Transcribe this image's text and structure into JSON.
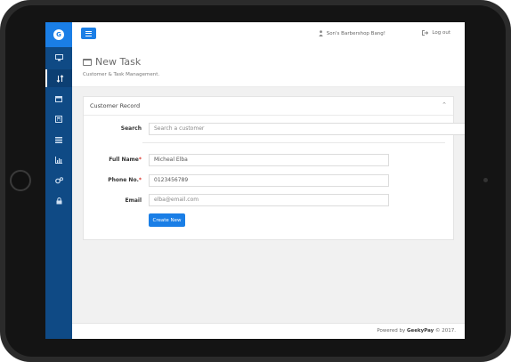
{
  "topbar": {
    "user_name": "Son's Barbershop Bang!",
    "logout_label": "Log out"
  },
  "page": {
    "title": "New Task",
    "subtitle": "Customer & Task Management."
  },
  "card": {
    "title": "Customer Record"
  },
  "form": {
    "search_label": "Search",
    "search_placeholder": "Search a customer",
    "fullname_label": "Full Name",
    "fullname_value": "Micheal Elba",
    "phone_label": "Phone No.",
    "phone_value": "0123456789",
    "email_label": "Email",
    "email_placeholder": "elba@email.com",
    "required_mark": "*",
    "create_label": "Create New"
  },
  "footer": {
    "prefix": "Powered by",
    "brand": "GeekyPay",
    "suffix": "© 2017."
  },
  "sidebar": {
    "items": [
      {
        "icon": "desktop-icon"
      },
      {
        "icon": "sort-icon"
      },
      {
        "icon": "calendar-icon"
      },
      {
        "icon": "calculator-icon"
      },
      {
        "icon": "list-icon"
      },
      {
        "icon": "bar-chart-icon"
      },
      {
        "icon": "cogs-icon"
      },
      {
        "icon": "lock-icon"
      }
    ]
  },
  "colors": {
    "accent": "#1a7ee6",
    "sidebar": "#0f4a85",
    "required": "#d9342b"
  }
}
